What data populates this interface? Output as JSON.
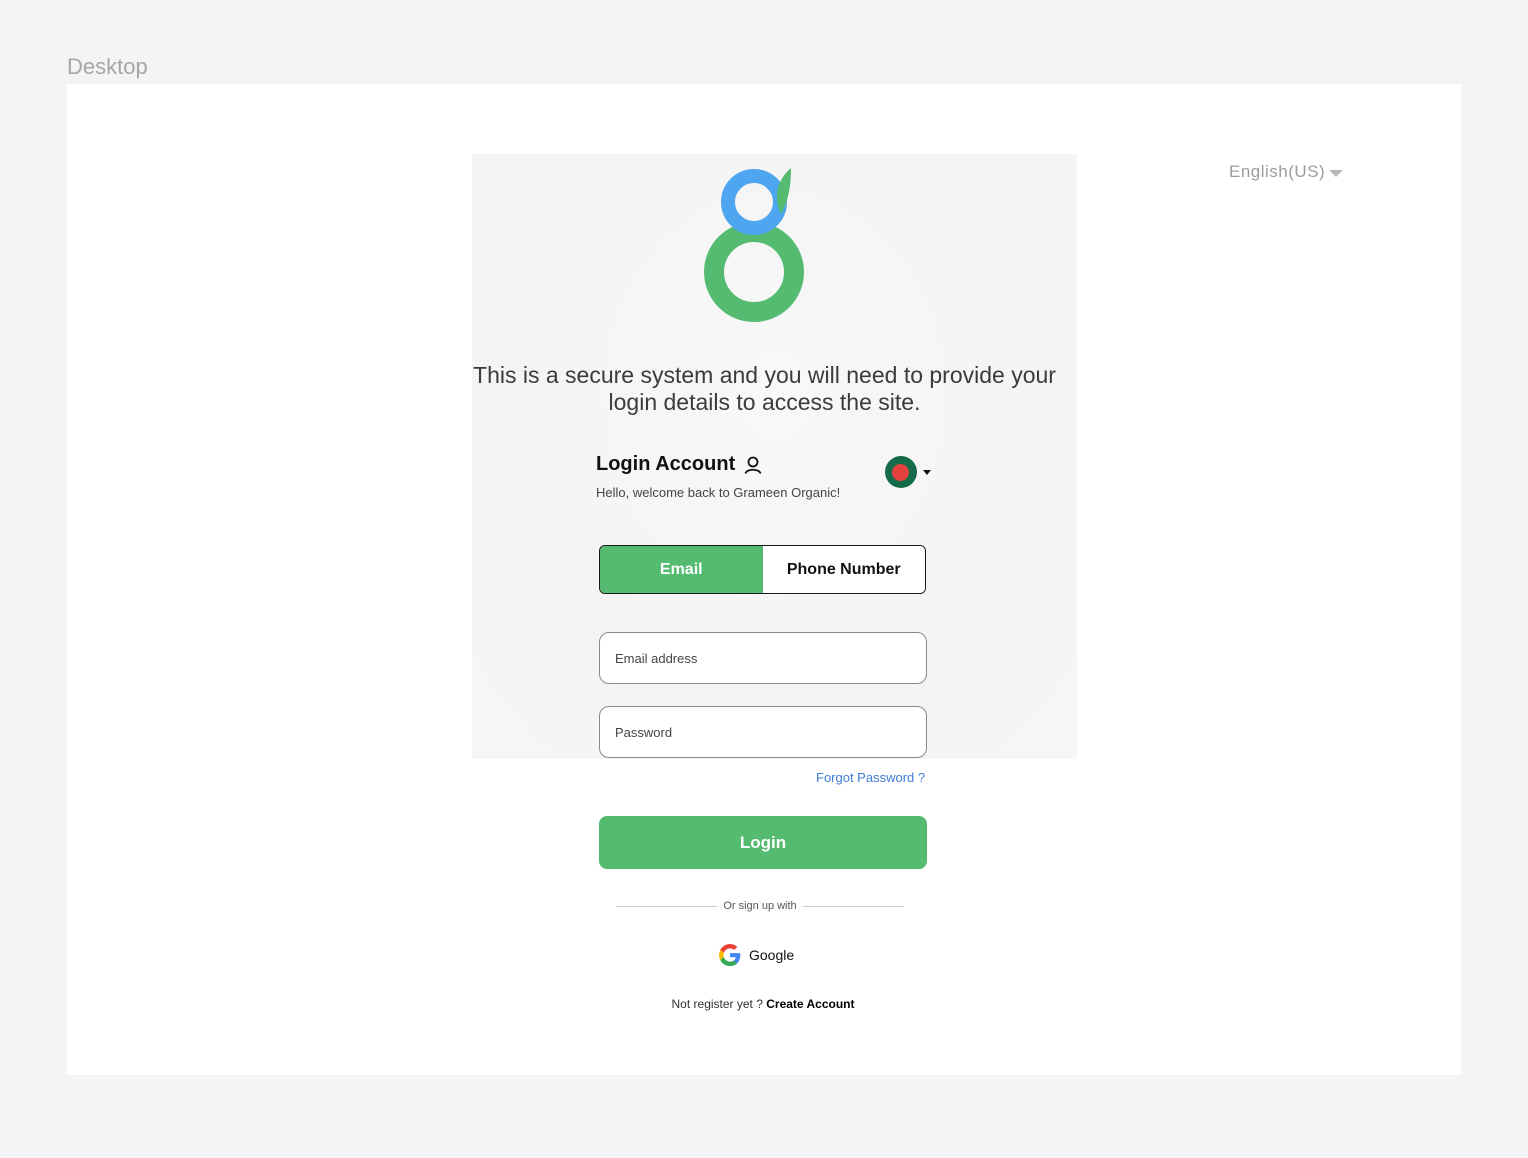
{
  "frame": {
    "label": "Desktop"
  },
  "language": {
    "selected": "English(US)"
  },
  "hero": {
    "message": "This is a secure system and you will need to provide your login details to access the site."
  },
  "login": {
    "title": "Login Account",
    "welcome": "Hello, welcome back to Grameen Organic!",
    "country_flag": "bangladesh-flag"
  },
  "tabs": [
    {
      "label": "Email",
      "active": true
    },
    {
      "label": "Phone Number",
      "active": false
    }
  ],
  "fields": {
    "email_placeholder": "Email address",
    "password_placeholder": "Password"
  },
  "forgot_password": "Forgot Password ?",
  "login_button": "Login",
  "divider_text": "Or sign up with",
  "google": {
    "label": "Google"
  },
  "register": {
    "prompt": "Not register yet ?",
    "link": "Create Account"
  },
  "colors": {
    "brand_green": "#55bb70",
    "brand_blue": "#4ea6f0",
    "link_blue": "#3f7fd6"
  }
}
